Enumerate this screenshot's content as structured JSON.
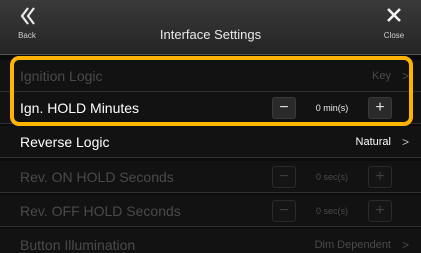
{
  "header": {
    "back_label": "Back",
    "title": "Interface Settings",
    "close_label": "Close"
  },
  "rows": [
    {
      "label": "Ignition Logic",
      "value": "Key",
      "chevron": ">",
      "enabled": false
    },
    {
      "label": "Ign. HOLD Minutes",
      "stepper_value": "0 min(s)",
      "minus": "−",
      "plus": "+",
      "enabled": true
    },
    {
      "label": "Reverse Logic",
      "value": "Natural",
      "chevron": ">",
      "enabled": true
    },
    {
      "label": "Rev. ON HOLD Seconds",
      "stepper_value": "0 sec(s)",
      "minus": "−",
      "plus": "+",
      "enabled": false
    },
    {
      "label": "Rev. OFF HOLD Seconds",
      "stepper_value": "0 sec(s)",
      "minus": "−",
      "plus": "+",
      "enabled": false
    },
    {
      "label": "Button Illumination",
      "value": "Dim Dependent",
      "chevron": ">",
      "enabled": false
    }
  ],
  "colors": {
    "highlight": "#ffb400",
    "disabled_text": "#4a4a4a",
    "background": "#0b0b0b"
  },
  "icons": {
    "back": "double-chevron-left-icon",
    "close": "close-x-icon"
  }
}
